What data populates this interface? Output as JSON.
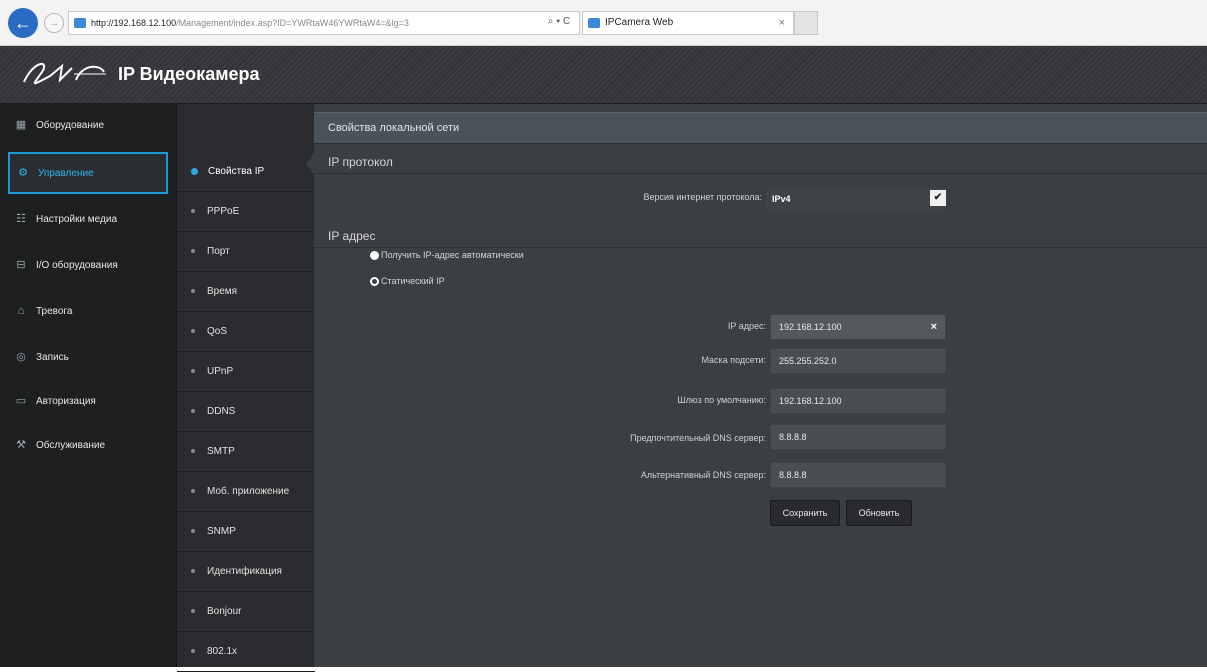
{
  "browser": {
    "url_host": "http://192.168.12.100",
    "url_path": "/Management/index.asp?ID=YWRtaW46YWRtaW4=&lg=3",
    "url_tools": "⌕ ▾ C",
    "tab_title": "IPCamera Web",
    "tab_close": "×"
  },
  "app": {
    "title": "IP Видеокамера"
  },
  "sidebar": {
    "items": [
      {
        "label": "Оборудование",
        "icon": "▦"
      },
      {
        "label": "Управление",
        "icon": "⚙"
      },
      {
        "label": "Настройки медиа",
        "icon": "☷"
      },
      {
        "label": "I/O оборудования",
        "icon": "⊟"
      },
      {
        "label": "Тревога",
        "icon": "⌂"
      },
      {
        "label": "Запись",
        "icon": "◎"
      },
      {
        "label": "Авторизация",
        "icon": "▭"
      },
      {
        "label": "Обслуживание",
        "icon": "⚒"
      }
    ]
  },
  "submenu": {
    "items": [
      {
        "label": "Свойства IP"
      },
      {
        "label": "PPPoE"
      },
      {
        "label": "Порт"
      },
      {
        "label": "Время"
      },
      {
        "label": "QoS"
      },
      {
        "label": "UPnP"
      },
      {
        "label": "DDNS"
      },
      {
        "label": "SMTP"
      },
      {
        "label": "Моб. приложение"
      },
      {
        "label": "SNMP"
      },
      {
        "label": "Идентификация"
      },
      {
        "label": "Bonjour"
      },
      {
        "label": "802.1x"
      }
    ]
  },
  "content": {
    "panel_title": "Свойства локальной сети",
    "ip_protocol": {
      "section_title": "IP протокол",
      "version_label": "Версия интернет протокола:",
      "version_value": "IPv4",
      "select_arrow": "✔"
    },
    "ip_address": {
      "section_title": "IP адрес",
      "radio_auto": "Получить IP-адрес автоматически",
      "radio_static": "Статический IP",
      "fields": [
        {
          "label": "IP адрес:",
          "value": "192.168.12.100"
        },
        {
          "label": "Маска подсети:",
          "value": "255.255.252.0"
        },
        {
          "label": "Шлюз по умолчанию:",
          "value": "192.168.12.100"
        },
        {
          "label": "Предпочтительный DNS сервер:",
          "value": "8.8.8.8"
        },
        {
          "label": "Альтернативный DNS сервер:",
          "value": "8.8.8.8"
        }
      ],
      "clear_symbol": "×"
    },
    "buttons": {
      "save": "Сохранить",
      "refresh": "Обновить"
    }
  }
}
